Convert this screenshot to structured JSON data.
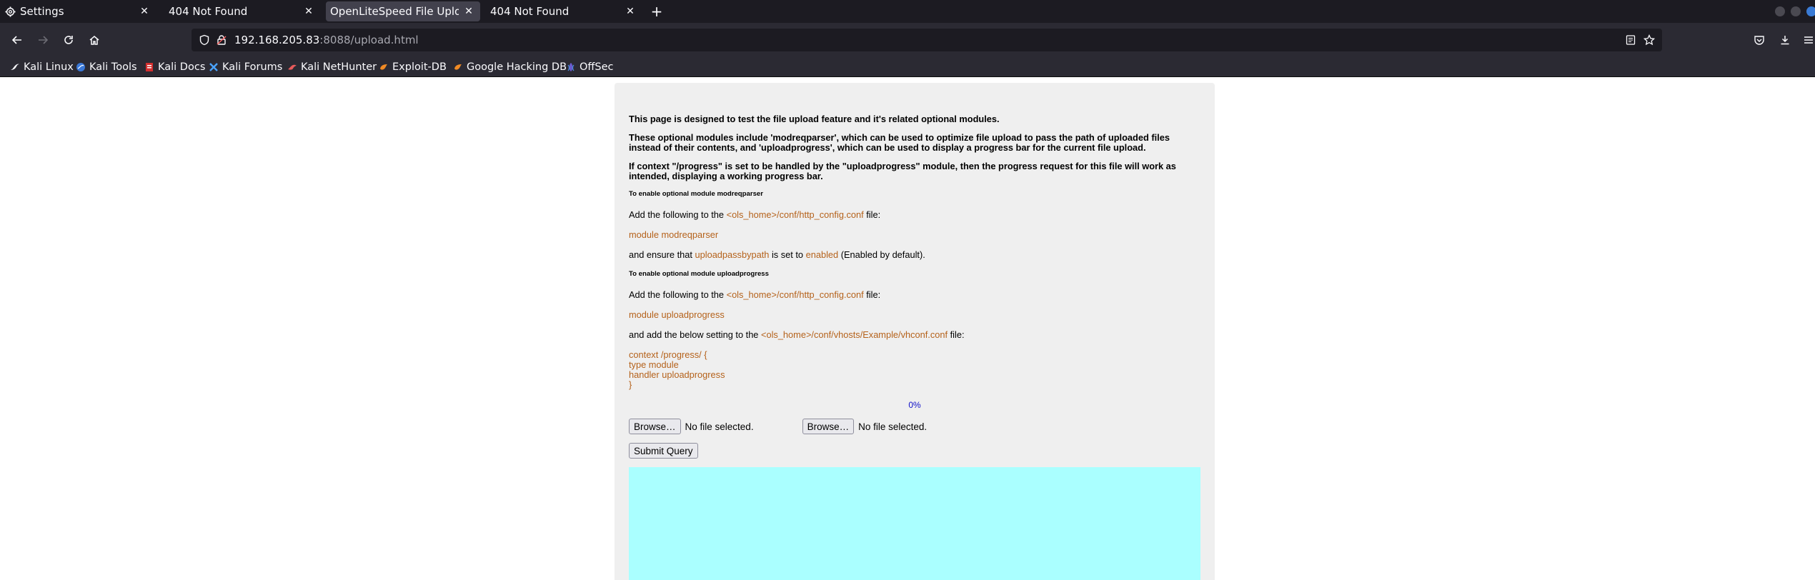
{
  "tabs": [
    {
      "title": "Settings",
      "icon": "gear-icon",
      "active": false
    },
    {
      "title": "404 Not Found",
      "icon": "",
      "active": false
    },
    {
      "title": "OpenLiteSpeed File Upload T",
      "icon": "",
      "active": true
    },
    {
      "title": "404 Not Found",
      "icon": "",
      "active": false
    }
  ],
  "tab_close_glyph": "✕",
  "new_tab_glyph": "+",
  "url": {
    "host": "192.168.205.83",
    "rest": ":8088/upload.html"
  },
  "bookmarks": [
    {
      "label": "Kali Linux",
      "icon": "kali-dragon-icon"
    },
    {
      "label": "Kali Tools",
      "icon": "kali-tools-icon"
    },
    {
      "label": "Kali Docs",
      "icon": "kali-docs-icon"
    },
    {
      "label": "Kali Forums",
      "icon": "kali-forums-icon"
    },
    {
      "label": "Kali NetHunter",
      "icon": "kali-nethunter-icon"
    },
    {
      "label": "Exploit-DB",
      "icon": "exploit-db-icon"
    },
    {
      "label": "Google Hacking DB",
      "icon": "ghdb-icon"
    },
    {
      "label": "OffSec",
      "icon": "offsec-icon"
    }
  ],
  "page": {
    "intro": "This page is designed to test the file upload feature and it's related optional modules.",
    "modules_desc": "These optional modules include 'modreqparser', which can be used to optimize file upload to pass the path of uploaded files instead of their contents, and 'uploadprogress', which can be used to display a progress bar for the current file upload.",
    "context_desc": "If context \"/progress\" is set to be handled by the \"uploadprogress\" module, then the progress request for this file will work as intended, displaying a working progress bar.",
    "h_modreqparser": "To enable optional module modreqparser",
    "add_following_prefix": "Add the following to the ",
    "http_config": "<ols_home>/conf/http_config.conf",
    "file_suffix": " file:",
    "module_modreqparser": "module modreqparser",
    "ensure_prefix": "and ensure that ",
    "uploadpassbypath": "uploadpassbypath",
    "is_set_to": " is set to ",
    "enabled": "enabled",
    "enabled_default": " (Enabled by default).",
    "h_uploadprogress": "To enable optional module uploadprogress",
    "module_uploadprogress": "module uploadprogress",
    "add_below_prefix": "and add the below setting to the ",
    "vhconf": "<ols_home>/conf/vhosts/Example/vhconf.conf",
    "context_lines": [
      "context /progress/ {",
      "type module",
      "handler uploadprogress",
      "}"
    ],
    "progress_percent": "0%",
    "browse_label": "Browse…",
    "no_file": "No file selected.",
    "submit_label": "Submit Query"
  },
  "colors": {
    "accent_code": "#b5621b",
    "progress_bg": "#aaffff",
    "percent": "#1010c8"
  }
}
